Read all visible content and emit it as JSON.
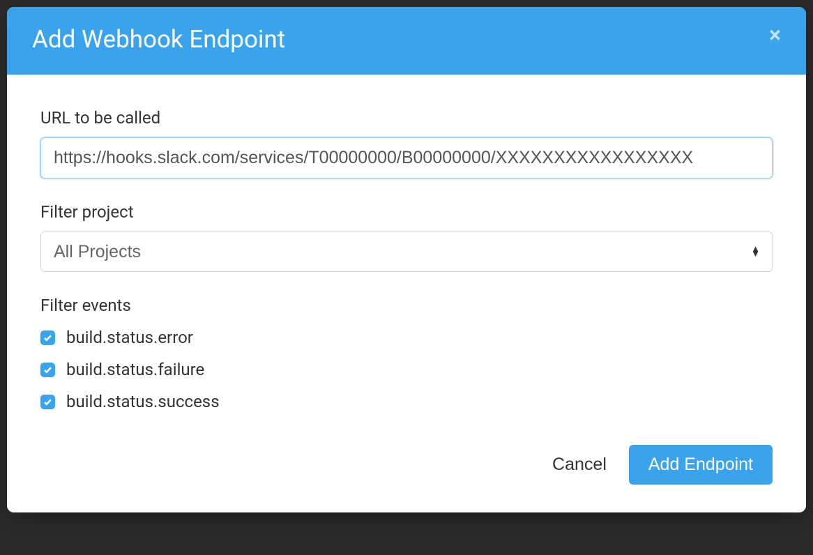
{
  "modal": {
    "title": "Add Webhook Endpoint",
    "url_label": "URL to be called",
    "url_value": "https://hooks.slack.com/services/T00000000/B00000000/XXXXXXXXXXXXXXXXX",
    "filter_project_label": "Filter project",
    "filter_project_value": "All Projects",
    "filter_events_label": "Filter events",
    "events": [
      {
        "label": "build.status.error",
        "checked": true
      },
      {
        "label": "build.status.failure",
        "checked": true
      },
      {
        "label": "build.status.success",
        "checked": true
      }
    ],
    "cancel_label": "Cancel",
    "submit_label": "Add Endpoint"
  }
}
